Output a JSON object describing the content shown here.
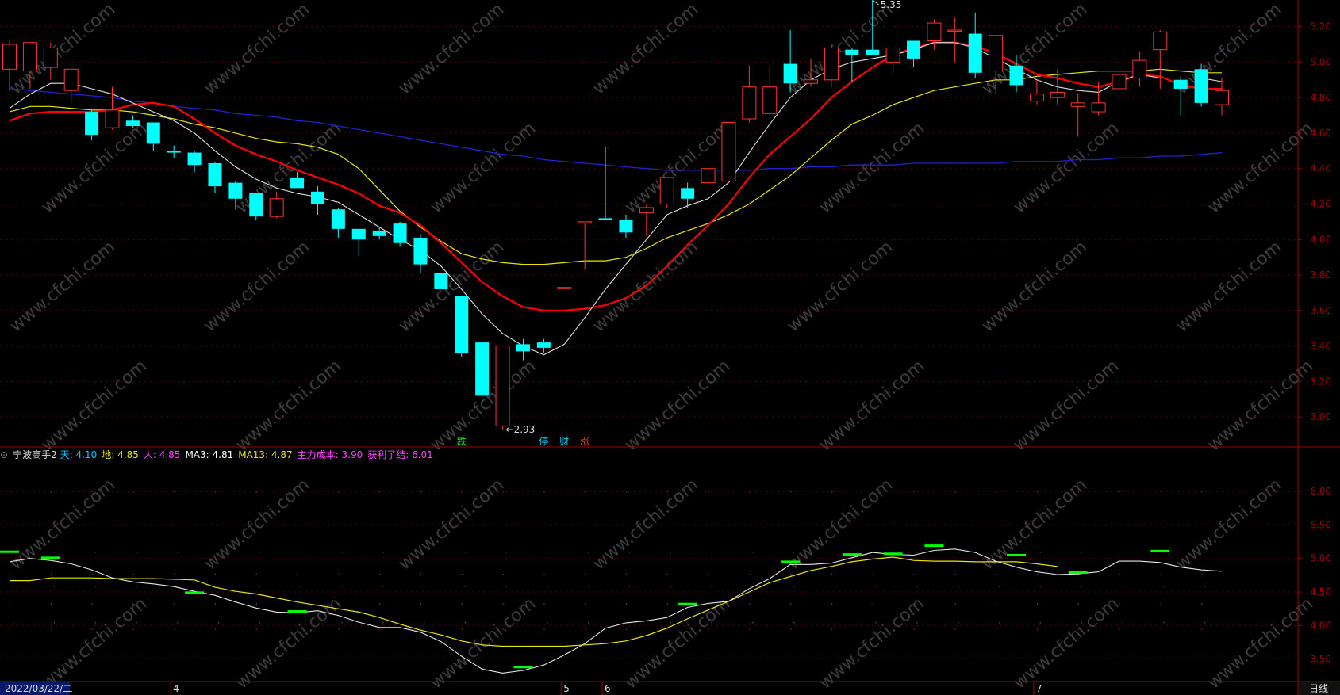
{
  "chart_data": {
    "type": "candlestick",
    "main": {
      "y_ticks": [
        3.0,
        3.2,
        3.4,
        3.6,
        3.8,
        4.0,
        4.2,
        4.4,
        4.6,
        4.8,
        5.0,
        5.2
      ],
      "ylim": [
        2.84,
        5.35
      ],
      "candles": [
        [
          4.96,
          5.12,
          4.84,
          5.1
        ],
        [
          4.95,
          5.1,
          4.85,
          5.11
        ],
        [
          4.97,
          5.11,
          4.9,
          5.08
        ],
        [
          4.84,
          4.92,
          4.77,
          4.96
        ],
        [
          4.72,
          4.73,
          4.56,
          4.59
        ],
        [
          4.63,
          4.86,
          4.62,
          4.73
        ],
        [
          4.67,
          4.7,
          4.63,
          4.64
        ],
        [
          4.66,
          4.66,
          4.5,
          4.54
        ],
        [
          4.5,
          4.53,
          4.46,
          4.49
        ],
        [
          4.49,
          4.5,
          4.38,
          4.42
        ],
        [
          4.43,
          4.44,
          4.26,
          4.3
        ],
        [
          4.32,
          4.33,
          4.17,
          4.23
        ],
        [
          4.26,
          4.26,
          4.11,
          4.13
        ],
        [
          4.13,
          4.27,
          4.12,
          4.23
        ],
        [
          4.35,
          4.38,
          4.29,
          4.29
        ],
        [
          4.27,
          4.3,
          4.14,
          4.2
        ],
        [
          4.17,
          4.18,
          4.01,
          4.06
        ],
        [
          4.06,
          4.06,
          3.91,
          4.0
        ],
        [
          4.05,
          4.07,
          4.0,
          4.02
        ],
        [
          4.09,
          4.1,
          3.96,
          3.98
        ],
        [
          4.01,
          4.03,
          3.81,
          3.86
        ],
        [
          3.81,
          3.81,
          3.72,
          3.72
        ],
        [
          3.68,
          3.68,
          3.34,
          3.36
        ],
        [
          3.42,
          3.42,
          3.08,
          3.12
        ],
        [
          2.95,
          3.4,
          2.93,
          3.4
        ],
        [
          3.41,
          3.44,
          3.32,
          3.37
        ],
        [
          3.42,
          3.44,
          3.36,
          3.39
        ],
        [
          3.73,
          3.73,
          3.73,
          3.73
        ],
        [
          4.1,
          4.1,
          3.83,
          4.1
        ],
        [
          4.12,
          4.52,
          4.12,
          4.11
        ],
        [
          4.11,
          4.14,
          4.01,
          4.04
        ],
        [
          4.15,
          4.2,
          4.02,
          4.18
        ],
        [
          4.2,
          4.35,
          4.18,
          4.35
        ],
        [
          4.29,
          4.32,
          4.18,
          4.23
        ],
        [
          4.32,
          4.4,
          4.22,
          4.4
        ],
        [
          4.33,
          4.66,
          4.32,
          4.66
        ],
        [
          4.68,
          4.98,
          4.66,
          4.86
        ],
        [
          4.71,
          4.97,
          4.71,
          4.86
        ],
        [
          4.99,
          5.18,
          4.83,
          4.88
        ],
        [
          4.88,
          5.02,
          4.86,
          4.9
        ],
        [
          4.9,
          5.1,
          4.86,
          5.08
        ],
        [
          5.07,
          5.08,
          4.89,
          5.04
        ],
        [
          5.07,
          5.35,
          5.04,
          5.04
        ],
        [
          5.0,
          5.08,
          4.94,
          5.08
        ],
        [
          5.12,
          5.07,
          4.97,
          5.02
        ],
        [
          5.12,
          5.24,
          5.07,
          5.22
        ],
        [
          5.18,
          5.25,
          5.0,
          5.18
        ],
        [
          5.16,
          5.28,
          4.91,
          4.94
        ],
        [
          4.95,
          5.13,
          4.82,
          5.15
        ],
        [
          4.98,
          5.04,
          4.83,
          4.87
        ],
        [
          4.78,
          4.9,
          4.76,
          4.82
        ],
        [
          4.8,
          4.96,
          4.76,
          4.83
        ],
        [
          4.75,
          4.82,
          4.58,
          4.77
        ],
        [
          4.72,
          4.89,
          4.7,
          4.77
        ],
        [
          4.85,
          5.02,
          4.81,
          4.93
        ],
        [
          4.91,
          5.06,
          4.86,
          5.01
        ],
        [
          5.07,
          5.18,
          4.85,
          5.17
        ],
        [
          4.9,
          4.92,
          4.7,
          4.85
        ],
        [
          4.96,
          4.99,
          4.75,
          4.77
        ],
        [
          4.76,
          4.91,
          4.7,
          4.84
        ]
      ],
      "ma_white": [
        4.74,
        4.82,
        4.88,
        4.88,
        4.85,
        4.82,
        4.77,
        4.72,
        4.67,
        4.6,
        4.5,
        4.41,
        4.34,
        4.29,
        4.26,
        4.24,
        4.21,
        4.14,
        4.07,
        4.0,
        3.94,
        3.85,
        3.72,
        3.58,
        3.47,
        3.4,
        3.35,
        3.41,
        3.56,
        3.72,
        3.86,
        4.0,
        4.14,
        4.19,
        4.23,
        4.32,
        4.49,
        4.65,
        4.8,
        4.9,
        4.96,
        5.0,
        5.02,
        5.04,
        5.07,
        5.11,
        5.11,
        5.08,
        5.02,
        4.96,
        4.9,
        4.86,
        4.84,
        4.83,
        4.89,
        4.93,
        4.91,
        4.91,
        4.91,
        4.89
      ],
      "ma_red": [
        4.67,
        4.71,
        4.72,
        4.72,
        4.72,
        4.73,
        4.76,
        4.77,
        4.75,
        4.68,
        4.6,
        4.53,
        4.48,
        4.44,
        4.39,
        4.35,
        4.31,
        4.26,
        4.19,
        4.15,
        4.08,
        3.98,
        3.87,
        3.76,
        3.68,
        3.62,
        3.6,
        3.6,
        3.61,
        3.63,
        3.67,
        3.74,
        3.85,
        3.97,
        4.08,
        4.2,
        4.35,
        4.48,
        4.58,
        4.68,
        4.8,
        4.89,
        4.97,
        5.04,
        5.08,
        5.11,
        5.11,
        5.09,
        5.05,
        4.99,
        4.93,
        4.91,
        4.88,
        4.86,
        4.89,
        4.93,
        4.92,
        4.87,
        4.85,
        4.85
      ],
      "ma_yellow": [
        4.72,
        4.75,
        4.75,
        4.74,
        4.73,
        4.73,
        4.72,
        4.7,
        4.68,
        4.65,
        4.63,
        4.6,
        4.57,
        4.55,
        4.54,
        4.52,
        4.48,
        4.4,
        4.28,
        4.16,
        4.07,
        3.99,
        3.92,
        3.89,
        3.87,
        3.86,
        3.86,
        3.87,
        3.88,
        3.88,
        3.9,
        3.95,
        4.01,
        4.05,
        4.09,
        4.14,
        4.2,
        4.28,
        4.36,
        4.46,
        4.56,
        4.65,
        4.7,
        4.76,
        4.8,
        4.84,
        4.86,
        4.88,
        4.9,
        4.9,
        4.92,
        4.93,
        4.94,
        4.95,
        4.95,
        4.95,
        4.96,
        4.95,
        4.94,
        4.94
      ],
      "ma_blue": [
        4.85,
        4.84,
        4.83,
        4.82,
        4.81,
        4.8,
        4.78,
        4.77,
        4.75,
        4.74,
        4.73,
        4.71,
        4.7,
        4.69,
        4.67,
        4.66,
        4.64,
        4.62,
        4.6,
        4.58,
        4.56,
        4.54,
        4.52,
        4.5,
        4.48,
        4.47,
        4.45,
        4.44,
        4.43,
        4.42,
        4.41,
        4.4,
        4.39,
        4.39,
        4.39,
        4.39,
        4.39,
        4.4,
        4.4,
        4.41,
        4.41,
        4.42,
        4.42,
        4.42,
        4.43,
        4.43,
        4.43,
        4.43,
        4.43,
        4.44,
        4.44,
        4.44,
        4.45,
        4.45,
        4.46,
        4.46,
        4.47,
        4.47,
        4.48,
        4.49
      ],
      "annotations": {
        "high_label": "5.35",
        "low_label": "←2.93"
      },
      "signals": [
        {
          "i": 22,
          "text": "跌",
          "color": "#00ff00"
        },
        {
          "i": 26,
          "text": "停",
          "color": "#00d0ff"
        },
        {
          "i": 27,
          "text": "财",
          "color": "#00d0ff"
        },
        {
          "i": 28,
          "text": "涨",
          "color": "#ff3333"
        }
      ]
    },
    "sub": {
      "y_ticks": [
        3.5,
        4.0,
        4.5,
        5.0,
        5.5,
        6.0
      ],
      "ylim": [
        3.2,
        6.45
      ],
      "white": [
        4.95,
        5.0,
        4.97,
        4.92,
        4.83,
        4.71,
        4.65,
        4.62,
        4.58,
        4.51,
        4.45,
        4.35,
        4.26,
        4.2,
        4.19,
        4.22,
        4.15,
        4.05,
        3.97,
        3.97,
        3.9,
        3.76,
        3.54,
        3.35,
        3.29,
        3.33,
        3.41,
        3.56,
        3.73,
        3.96,
        4.04,
        4.07,
        4.12,
        4.27,
        4.33,
        4.36,
        4.55,
        4.7,
        4.91,
        4.91,
        4.93,
        5.01,
        5.09,
        5.06,
        5.05,
        5.12,
        5.14,
        5.09,
        4.96,
        4.87,
        4.8,
        4.76,
        4.77,
        4.8,
        4.96,
        4.96,
        4.94,
        4.87,
        4.83,
        4.81
      ],
      "yellow": [
        4.67,
        4.67,
        4.71,
        4.71,
        4.71,
        4.7,
        4.7,
        4.7,
        4.69,
        4.68,
        4.57,
        4.51,
        4.47,
        4.41,
        4.35,
        4.3,
        4.25,
        4.2,
        4.12,
        4.02,
        3.93,
        3.86,
        3.77,
        3.71,
        3.69,
        3.69,
        3.69,
        3.69,
        3.71,
        3.73,
        3.77,
        3.85,
        3.96,
        4.1,
        4.23,
        4.36,
        4.5,
        4.64,
        4.73,
        4.82,
        4.88,
        4.95,
        4.99,
        5.02,
        4.97,
        4.96,
        4.96,
        4.95,
        4.95,
        4.95,
        4.92,
        4.88
      ],
      "markers": [
        {
          "i": 0,
          "v": 5.1
        },
        {
          "i": 2,
          "v": 5.01
        },
        {
          "i": 9,
          "v": 4.49
        },
        {
          "i": 14,
          "v": 4.21
        },
        {
          "i": 25,
          "v": 3.38
        },
        {
          "i": 33,
          "v": 4.32
        },
        {
          "i": 38,
          "v": 4.95
        },
        {
          "i": 41,
          "v": 5.06
        },
        {
          "i": 43,
          "v": 5.07
        },
        {
          "i": 45,
          "v": 5.19
        },
        {
          "i": 49,
          "v": 5.05
        },
        {
          "i": 52,
          "v": 4.79
        },
        {
          "i": 56,
          "v": 5.11
        }
      ]
    },
    "x_labels": [
      {
        "i": 0,
        "text": "2022/03/22/二"
      },
      {
        "i": 8,
        "text": "4"
      },
      {
        "i": 27,
        "text": "5"
      },
      {
        "i": 29,
        "text": "6"
      },
      {
        "i": 50,
        "text": "7"
      }
    ],
    "period_label": "日线"
  },
  "indicator_header": {
    "name": "宁波高手2",
    "tian": "天: 4.10",
    "di": "地: 4.85",
    "ren": "人: 4.85",
    "ma3": "MA3: 4.81",
    "ma13": "MA13: 4.87",
    "cost": "主力成本: 3.90",
    "profit": "获利了结: 6.01"
  },
  "colors": {
    "up": "#ff3333",
    "down": "#00ffff",
    "ma_white": "#dddddd",
    "ma_red": "#ff0000",
    "ma_yellow": "#e6e600",
    "ma_blue": "#2222cc",
    "axis": "#a00000",
    "marker": "#00ff00"
  },
  "watermark": "www.cfchi.com"
}
